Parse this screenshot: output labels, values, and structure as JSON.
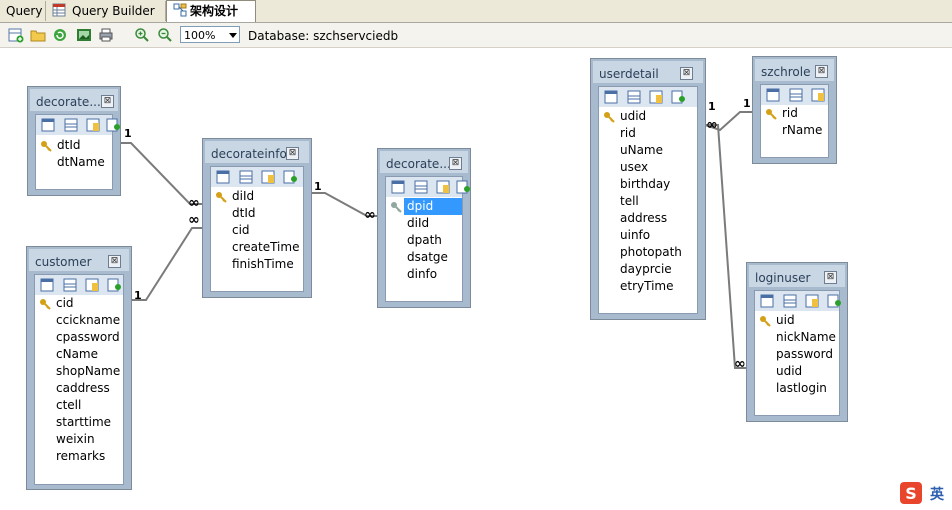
{
  "tabs": [
    {
      "label": "Query",
      "active": false
    },
    {
      "label": "Query Builder",
      "active": false
    },
    {
      "label": "架构设计器",
      "active": true
    }
  ],
  "toolbar": {
    "zoom_value": "100%",
    "database_label": "Database: szchservciedb"
  },
  "tables": {
    "decoratetype": {
      "title": "decorate...",
      "fields": [
        "dtId",
        "dtName"
      ]
    },
    "customer": {
      "title": "customer",
      "fields": [
        "cid",
        "ccickname",
        "cpassword",
        "cName",
        "shopName",
        "caddress",
        "ctell",
        "starttime",
        "weixin",
        "remarks"
      ]
    },
    "decorateinfo": {
      "title": "decorateinfo",
      "fields": [
        "diId",
        "dtId",
        "cid",
        "createTime",
        "finishTime"
      ]
    },
    "decoratepic": {
      "title": "decorate...",
      "fields": [
        "dpid",
        "diId",
        "dpath",
        "dsatge",
        "dinfo"
      ],
      "selected": "dpid"
    },
    "userdetail": {
      "title": "userdetail",
      "fields": [
        "udid",
        "rid",
        "uName",
        "usex",
        "birthday",
        "tell",
        "address",
        "uinfo",
        "photopath",
        "dayprcie",
        "etryTime"
      ]
    },
    "szchrole": {
      "title": "szchrole",
      "fields": [
        "rid",
        "rName"
      ]
    },
    "loginuser": {
      "title": "loginuser",
      "fields": [
        "uid",
        "nickName",
        "password",
        "udid",
        "lastlogin"
      ]
    }
  },
  "relations": {
    "one": "1",
    "many": "∞"
  },
  "ime": {
    "label": "英"
  },
  "colors": {
    "accent_select": "#3399ff",
    "table_frame": "#a7bace",
    "key_gold": "#d4a017"
  }
}
